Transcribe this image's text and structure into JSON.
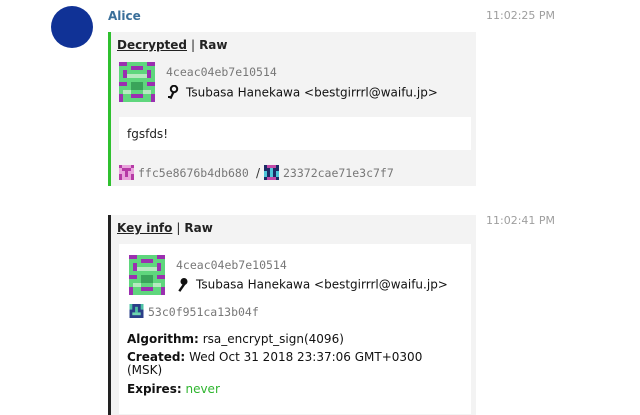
{
  "message": {
    "sender": "Alice",
    "avatar_color": "#103296",
    "timestamp": "11:02:25 PM",
    "tabs": {
      "active": "Decrypted",
      "separator": "|",
      "other": "Raw"
    },
    "signer": {
      "fingerprint": "4ceac04eb7e10514",
      "uid": "Tsubasa Hanekawa <bestgirrrl@waifu.jp>",
      "key_icon": "key-icon"
    },
    "body": "fgsfds!",
    "footer": {
      "hash_a": "ffc5e8676b4db680",
      "divider": "/",
      "hash_b": "23372cae71e3c7f7"
    }
  },
  "key_event": {
    "timestamp": "11:02:41 PM",
    "tabs": {
      "active": "Key info",
      "separator": "|",
      "other": "Raw"
    },
    "key": {
      "fingerprint": "4ceac04eb7e10514",
      "uid": "Tsubasa Hanekawa <bestgirrrl@waifu.jp>",
      "sub_hash": "53c0f951ca13b04f",
      "algorithm_label": "Algorithm:",
      "algorithm": "rsa_encrypt_sign(4096)",
      "created_label": "Created:",
      "created": "Wed Oct 31 2018 23:37:06 GMT+0300 (MSK)",
      "expires_label": "Expires:",
      "expires": "never"
    }
  },
  "colors": {
    "verified_border": "#2fc02f",
    "expires_never": "#2fb52f",
    "sender": "#3a6f9a"
  }
}
